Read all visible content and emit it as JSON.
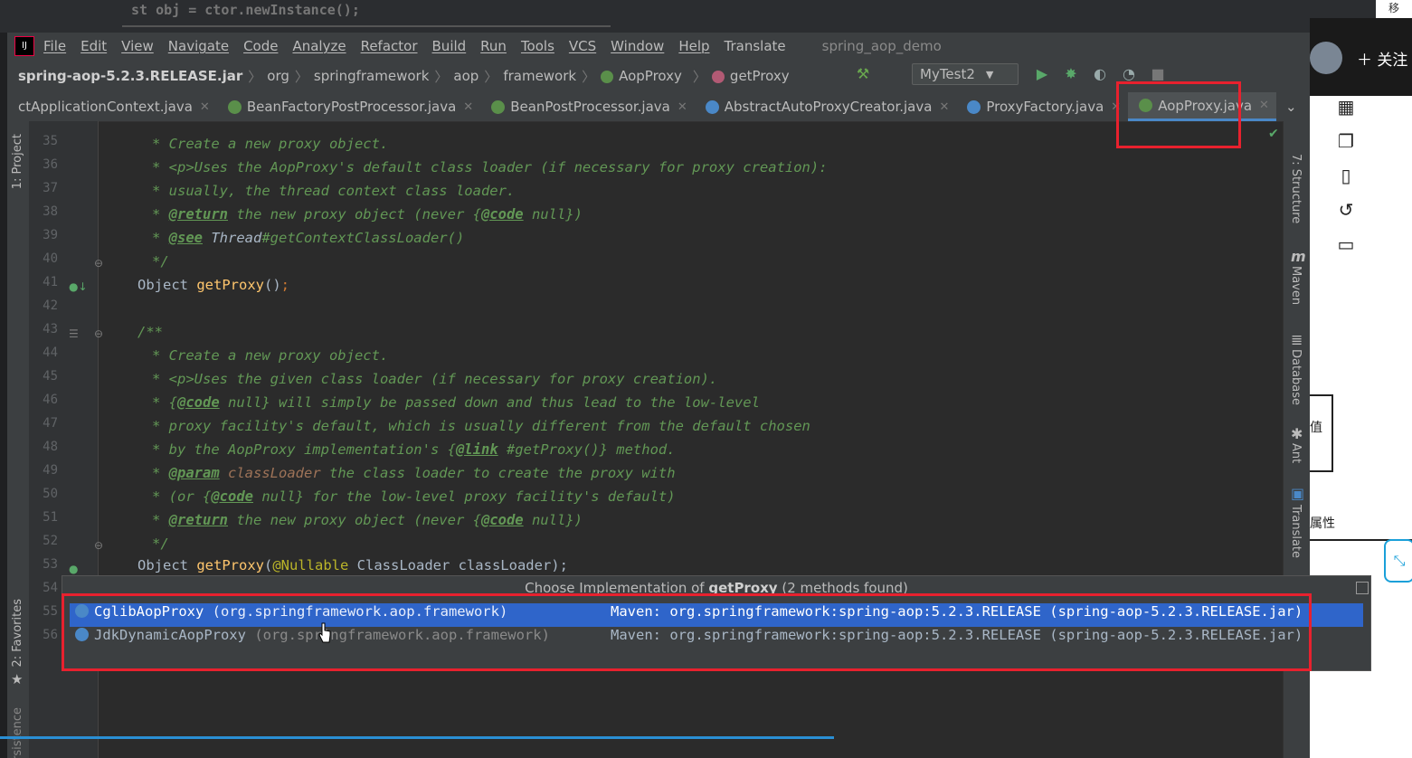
{
  "background_editor_text": "st obj = ctor.newInstance();",
  "corner_text": "移",
  "menu": {
    "items": [
      "File",
      "Edit",
      "View",
      "Navigate",
      "Code",
      "Analyze",
      "Refactor",
      "Build",
      "Run",
      "Tools",
      "VCS",
      "Window",
      "Help",
      "Translate"
    ],
    "project": "spring_aop_demo"
  },
  "breadcrumb": {
    "jar": "spring-aop-5.2.3.RELEASE.jar",
    "p1": "org",
    "p2": "springframework",
    "p3": "aop",
    "p4": "framework",
    "cls": "AopProxy",
    "method": "getProxy"
  },
  "toolbar": {
    "run_config": "MyTest2"
  },
  "tabs": [
    {
      "label": "ctApplicationContext.java",
      "icon_color": ""
    },
    {
      "label": "BeanFactoryPostProcessor.java",
      "icon_color": "#5a8f4a"
    },
    {
      "label": "BeanPostProcessor.java",
      "icon_color": "#5a8f4a"
    },
    {
      "label": "AbstractAutoProxyCreator.java",
      "icon_color": "#4a88c7"
    },
    {
      "label": "ProxyFactory.java",
      "icon_color": "#4a88c7"
    },
    {
      "label": "AopProxy.java",
      "icon_color": "#5a8f4a"
    }
  ],
  "left_toolwindows": {
    "project": "1: Project",
    "favorites": "2: Favorites",
    "persistence": "Persistence"
  },
  "right_toolwindows": {
    "structure": "7: Structure",
    "maven": "Maven",
    "database": "Database",
    "ant": "Ant",
    "translate": "Translate"
  },
  "line_numbers": [
    "35",
    "36",
    "37",
    "38",
    "39",
    "40",
    "41",
    "42",
    "43",
    "44",
    "45",
    "46",
    "47",
    "48",
    "49",
    "50",
    "51",
    "52",
    "53",
    "54",
    "55",
    "56"
  ],
  "code": {
    "l35": "* Create a new proxy object.",
    "l36a": "* <p>",
    "l36b": "Uses the AopProxy's default class loader (if necessary for proxy creation):",
    "l37": "* usually, the thread context class loader.",
    "l38a": "* ",
    "l38tag": "@return",
    "l38b": " the new proxy object (never {",
    "l38code": "@code",
    "l38c": " null})",
    "l39a": "* ",
    "l39tag": "@see",
    "l39b": " Thread",
    "l39c": "#getContextClassLoader()",
    "l40": "*/",
    "l41a": "Object ",
    "l41fn": "getProxy",
    "l41b": "()",
    "l41semi": ";",
    "l43": "/**",
    "l44": "* Create a new proxy object.",
    "l45a": "* <p>",
    "l45b": "Uses the given class loader (if necessary for proxy creation).",
    "l46a": "* {",
    "l46code": "@code",
    "l46b": " null} will simply be passed down and thus lead to the low-level",
    "l47": "* proxy facility's default, which is usually different from the default chosen",
    "l48a": "* by the AopProxy implementation's {",
    "l48link": "@link",
    "l48b": " #getProxy()} method.",
    "l49a": "* ",
    "l49tag": "@param",
    "l49p": " classLoader",
    "l49b": " the class loader to create the proxy with",
    "l50a": "* (or {",
    "l50code": "@code",
    "l50b": " null} for the low-level proxy facility's default)",
    "l51a": "* ",
    "l51tag": "@return",
    "l51b": " the new proxy object (never {",
    "l51code": "@code",
    "l51c": " null})",
    "l52": "*/",
    "l53a": "Object ",
    "l53fn": "getProxy",
    "l53b": "(",
    "l53an": "@Nullable",
    "l53c": " ClassLoader classLoader);"
  },
  "popup": {
    "title_prefix": "Choose Implementation of ",
    "title_method": "getProxy",
    "title_suffix": " (2 methods found)",
    "rows": [
      {
        "cls": "CglibAopProxy",
        "pkg": " (org.springframework.aop.framework)",
        "maven": "Maven: org.springframework:spring-aop:5.2.3.RELEASE (spring-aop-5.2.3.RELEASE.jar)"
      },
      {
        "cls": "JdkDynamicAopProxy",
        "pkg": " (org.springframework.aop.framework)",
        "maven": "Maven: org.springframework:spring-aop:5.2.3.RELEASE (spring-aop-5.2.3.RELEASE.jar)"
      }
    ]
  },
  "web_sidebar": {
    "follow": "关注",
    "partial1": "值",
    "partial2": "属性"
  },
  "colors": {
    "selection": "#2f65ca",
    "annotation_red": "#e8212e",
    "comment_green": "#629755"
  }
}
